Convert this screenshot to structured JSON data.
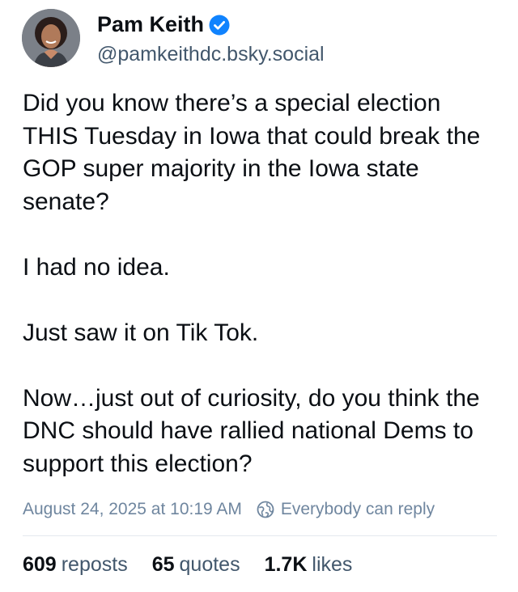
{
  "author": {
    "name": "Pam Keith",
    "handle": "@pamkeithdc.bsky.social",
    "verified_icon": "verified-check-icon",
    "verified_color": "#1083fe"
  },
  "post": {
    "paragraphs": [
      "Did you know there’s a special election THIS Tuesday in Iowa that could break the GOP super majority in the Iowa state senate?",
      "I had no idea.",
      "Just saw it on Tik Tok.",
      "Now…just out of curiosity, do you think the DNC should have rallied national Dems to support this election?"
    ]
  },
  "meta": {
    "timestamp": "August 24, 2025 at 10:19 AM",
    "reply_setting": "Everybody can reply",
    "reply_icon": "globe-icon"
  },
  "stats": {
    "reposts_count": "609",
    "reposts_label": "reposts",
    "quotes_count": "65",
    "quotes_label": "quotes",
    "likes_count": "1.7K",
    "likes_label": "likes"
  },
  "colors": {
    "text": "#0b0f14",
    "secondary": "#42576c",
    "muted": "#6f869f",
    "accent": "#1083fe"
  }
}
